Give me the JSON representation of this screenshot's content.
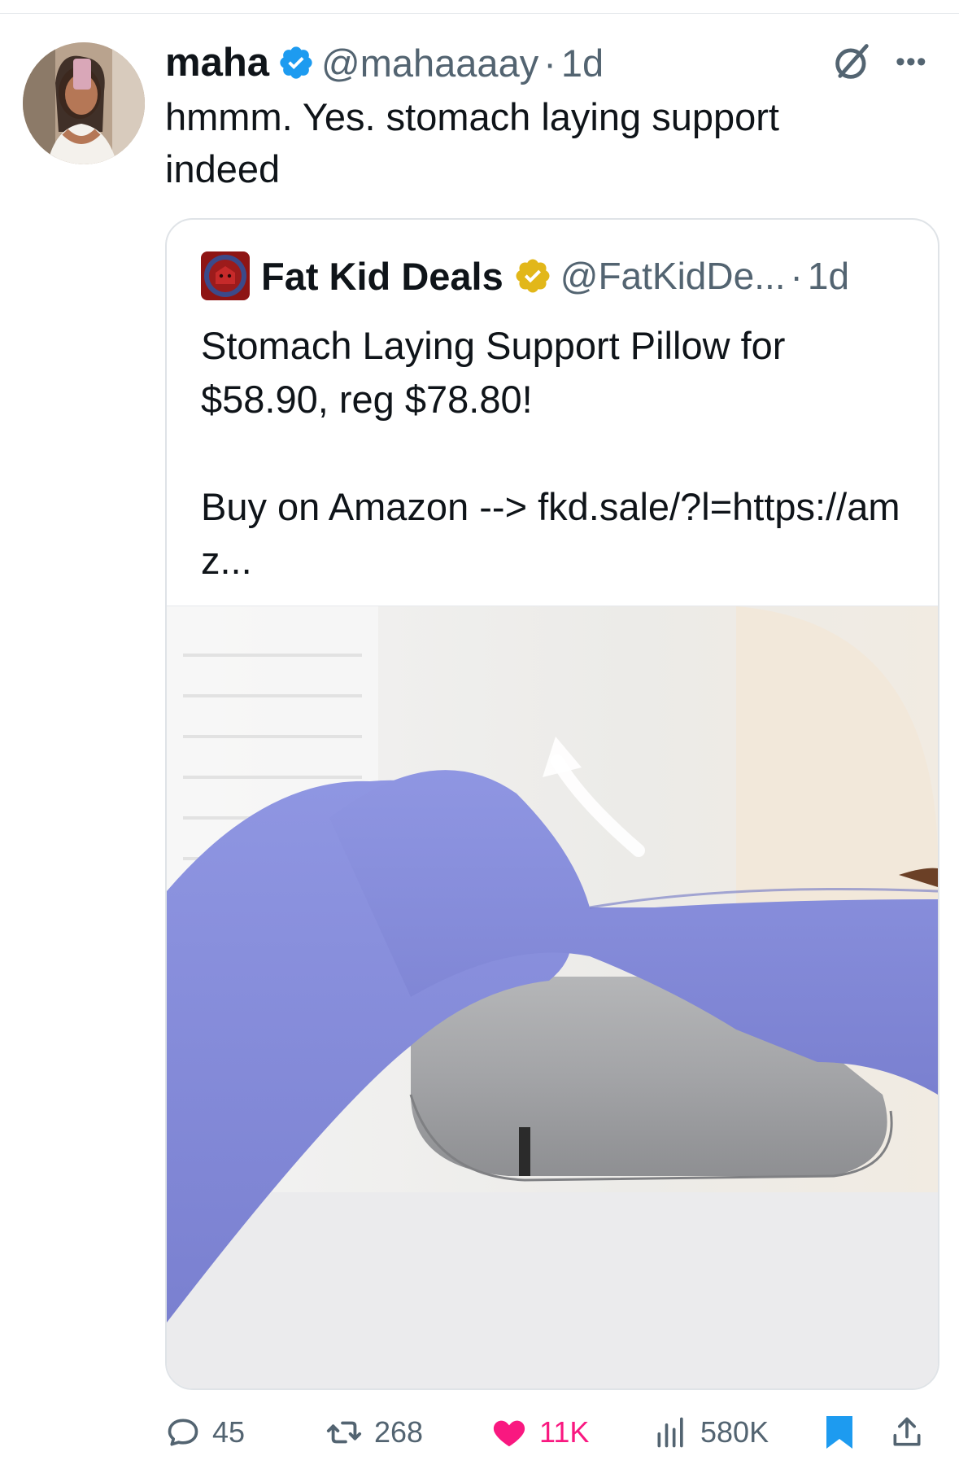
{
  "tweet": {
    "author_name": "maha",
    "handle": "@mahaaaay",
    "separator": "·",
    "time": "1d",
    "text": "hmmm. Yes. stomach laying support indeed"
  },
  "quoted": {
    "author_name": "Fat Kid Deals",
    "handle": "@FatKidDe...",
    "separator": "·",
    "time": "1d",
    "line1": "Stomach Laying Support Pillow for $58.90, reg $78.80!",
    "line2": "Buy on Amazon --> fkd.sale/?l=https://amz..."
  },
  "actions": {
    "replies": "45",
    "reposts": "268",
    "likes": "11K",
    "views": "580K"
  },
  "colors": {
    "verified_blue": "#1d9bf0",
    "verified_gold": "#e2b719",
    "like_pink": "#f91880",
    "bookmark_blue": "#1d9bf0",
    "muted_text": "#536471"
  },
  "icons": [
    "verified-badge-icon",
    "grok-icon",
    "more-icon",
    "gold-verified-badge-icon",
    "reply-icon",
    "repost-icon",
    "like-icon",
    "views-icon",
    "bookmark-icon",
    "share-icon"
  ]
}
